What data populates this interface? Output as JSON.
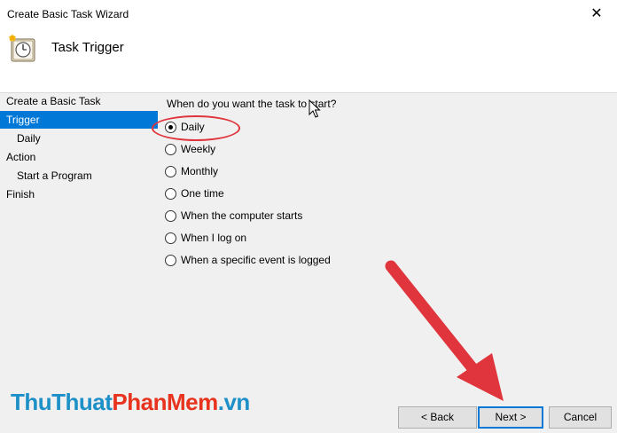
{
  "window": {
    "title": "Create Basic Task Wizard",
    "close_glyph": "✕"
  },
  "header": {
    "title": "Task Trigger",
    "icon": "clock-icon"
  },
  "sidebar": {
    "items": [
      {
        "label": "Create a Basic Task",
        "active": false
      },
      {
        "label": "Trigger",
        "active": true
      },
      {
        "label": "Daily",
        "active": false
      },
      {
        "label": "Action",
        "active": false
      },
      {
        "label": "Start a Program",
        "active": false
      },
      {
        "label": "Finish",
        "active": false
      }
    ]
  },
  "main": {
    "question": "When do you want the task to start?",
    "options": [
      {
        "label": "Daily",
        "selected": true
      },
      {
        "label": "Weekly",
        "selected": false
      },
      {
        "label": "Monthly",
        "selected": false
      },
      {
        "label": "One time",
        "selected": false
      },
      {
        "label": "When the computer starts",
        "selected": false
      },
      {
        "label": "When I log on",
        "selected": false
      },
      {
        "label": "When a specific event is logged",
        "selected": false
      }
    ]
  },
  "buttons": {
    "back": "< Back",
    "next": "Next >",
    "cancel": "Cancel"
  },
  "watermark": {
    "part1": "ThuThuat",
    "part2": "PhanMem",
    "part3": ".vn"
  },
  "colors": {
    "accent": "#0078d7",
    "annotation": "#e0353c"
  }
}
